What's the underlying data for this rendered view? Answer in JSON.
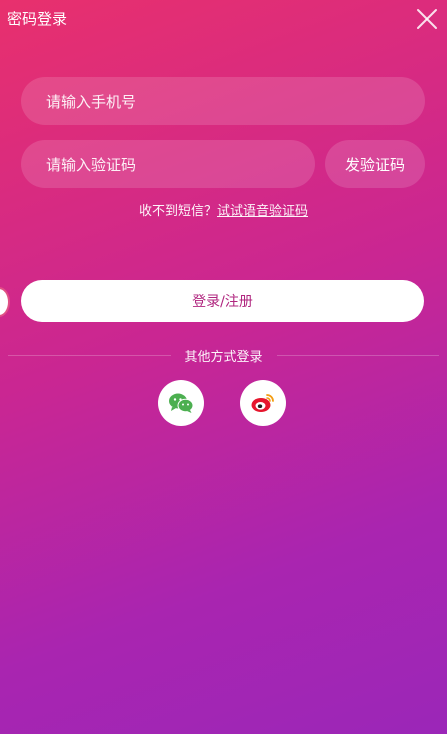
{
  "header": {
    "title": "密码登录",
    "close_icon": "close-icon"
  },
  "form": {
    "phone_placeholder": "请输入手机号",
    "code_placeholder": "请输入验证码",
    "send_code_label": "发验证码",
    "sms_hint_prefix": "收不到短信？",
    "voice_code_link": "试试语音验证码",
    "login_label": "登录/注册"
  },
  "social": {
    "divider_label": "其他方式登录",
    "items": [
      {
        "icon": "wechat-icon",
        "color": "#4caf50"
      },
      {
        "icon": "weibo-icon",
        "color": "#e6162d"
      }
    ]
  },
  "colors": {
    "gradient_top": "#e8306d",
    "gradient_bottom": "#9b26b8",
    "login_text": "#b0267f"
  }
}
